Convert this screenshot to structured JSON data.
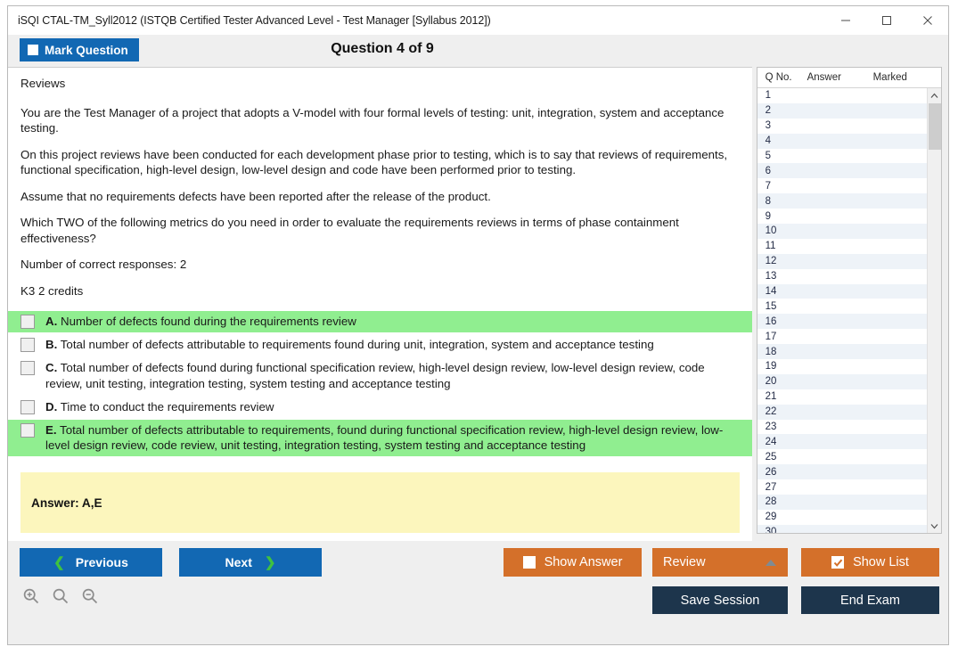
{
  "window": {
    "title": "iSQI CTAL-TM_Syll2012 (ISTQB Certified Tester Advanced Level - Test Manager [Syllabus 2012])",
    "controls": {
      "minimize": "minimize-icon",
      "maximize": "maximize-icon",
      "close": "close-icon"
    }
  },
  "header": {
    "mark_label": "Mark Question",
    "question_title": "Question 4 of 9"
  },
  "question": {
    "topic": "Reviews",
    "paragraphs": [
      "You are the Test Manager of a project that adopts a V-model with four formal levels of testing: unit, integration, system and acceptance testing.",
      "On this project reviews have been conducted for each development phase prior to testing, which is to say that reviews of requirements, functional specification, high-level design, low-level design and code have been performed prior to testing.",
      "Assume that no requirements defects have been reported after the release of the product.",
      "Which TWO of the following metrics do you need in order to evaluate the requirements reviews in terms of phase containment effectiveness?",
      "Number of correct responses: 2",
      "K3 2 credits"
    ],
    "options": [
      {
        "letter": "A.",
        "text": "Number of defects found during the requirements review",
        "correct": true
      },
      {
        "letter": "B.",
        "text": "Total number of defects attributable to requirements found during unit, integration, system and acceptance testing",
        "correct": false
      },
      {
        "letter": "C.",
        "text": "Total number of defects found during functional specification review, high-level design review, low-level design review, code review, unit testing, integration testing, system testing and acceptance testing",
        "correct": false
      },
      {
        "letter": "D.",
        "text": "Time to conduct the requirements review",
        "correct": false
      },
      {
        "letter": "E.",
        "text": "Total number of defects attributable to requirements, found during functional specification review, high-level design review, low-level design review, code review, unit testing, integration testing, system testing and acceptance testing",
        "correct": true
      }
    ],
    "answer_label": "Answer: A,E"
  },
  "list_panel": {
    "columns": [
      "Q No.",
      "Answer",
      "Marked"
    ],
    "rows": [
      {
        "no": "1",
        "answer": "",
        "marked": ""
      },
      {
        "no": "2",
        "answer": "",
        "marked": ""
      },
      {
        "no": "3",
        "answer": "",
        "marked": ""
      },
      {
        "no": "4",
        "answer": "",
        "marked": ""
      },
      {
        "no": "5",
        "answer": "",
        "marked": ""
      },
      {
        "no": "6",
        "answer": "",
        "marked": ""
      },
      {
        "no": "7",
        "answer": "",
        "marked": ""
      },
      {
        "no": "8",
        "answer": "",
        "marked": ""
      },
      {
        "no": "9",
        "answer": "",
        "marked": ""
      },
      {
        "no": "10",
        "answer": "",
        "marked": ""
      },
      {
        "no": "11",
        "answer": "",
        "marked": ""
      },
      {
        "no": "12",
        "answer": "",
        "marked": ""
      },
      {
        "no": "13",
        "answer": "",
        "marked": ""
      },
      {
        "no": "14",
        "answer": "",
        "marked": ""
      },
      {
        "no": "15",
        "answer": "",
        "marked": ""
      },
      {
        "no": "16",
        "answer": "",
        "marked": ""
      },
      {
        "no": "17",
        "answer": "",
        "marked": ""
      },
      {
        "no": "18",
        "answer": "",
        "marked": ""
      },
      {
        "no": "19",
        "answer": "",
        "marked": ""
      },
      {
        "no": "20",
        "answer": "",
        "marked": ""
      },
      {
        "no": "21",
        "answer": "",
        "marked": ""
      },
      {
        "no": "22",
        "answer": "",
        "marked": ""
      },
      {
        "no": "23",
        "answer": "",
        "marked": ""
      },
      {
        "no": "24",
        "answer": "",
        "marked": ""
      },
      {
        "no": "25",
        "answer": "",
        "marked": ""
      },
      {
        "no": "26",
        "answer": "",
        "marked": ""
      },
      {
        "no": "27",
        "answer": "",
        "marked": ""
      },
      {
        "no": "28",
        "answer": "",
        "marked": ""
      },
      {
        "no": "29",
        "answer": "",
        "marked": ""
      },
      {
        "no": "30",
        "answer": "",
        "marked": ""
      }
    ]
  },
  "footer": {
    "previous_label": "Previous",
    "next_label": "Next",
    "show_answer_label": "Show Answer",
    "review_label": "Review",
    "show_list_label": "Show List",
    "save_session_label": "Save Session",
    "end_exam_label": "End Exam",
    "zoom_in_icon": "zoom-in-icon",
    "zoom_reset_icon": "zoom-reset-icon",
    "zoom_out_icon": "zoom-out-icon"
  },
  "colors": {
    "accent_blue": "#1268b3",
    "accent_orange": "#d4702a",
    "navy": "#1d354c",
    "correct_green": "#90ee90",
    "answer_yellow": "#fcf6bd",
    "chevron_green": "#3fc23f"
  }
}
